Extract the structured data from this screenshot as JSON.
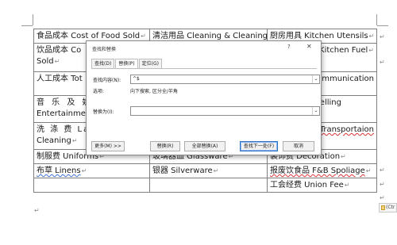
{
  "table": {
    "rows": [
      [
        "食品成本 Cost of Food Sold",
        "清洁用品 Cleaning & Cleaning",
        "厨房用具 Kitchen Utensils"
      ],
      [
        "饮品成本 Cost of Beverage Sold",
        "",
        "厨房燃料 Kitchen Fuel"
      ],
      [
        "人工成本 Total Labor Cost",
        "",
        "通讯费 Communication"
      ],
      [
        "音乐及娱乐 Music & Entertainment",
        "",
        "差旅费 Travelling"
      ],
      [
        "洗涤费 Laundry & Dry Cleaning",
        "",
        "交通费 Transportaion"
      ],
      [
        "制服费 Uniforms",
        "玻璃器皿 Glassware",
        "装饰费 Decoration"
      ],
      [
        "布草 Linens",
        "银器 Silverware",
        "报废饮食品 F&B Spoliage"
      ],
      [
        "",
        "",
        "工会经费 Union Fee"
      ]
    ],
    "visible_fragments": {
      "r1c0_line1": "饮品成本 Co",
      "r1c0_line2": "Sold",
      "r1c2": "Kitchen Fuel",
      "r2c0": "人工成本 Tot",
      "r2c2": "ommunication",
      "r3c0_line1": "音 乐 及 娱",
      "r3c0_line2": "Entertainmen",
      "r3c2": "费",
      "r3c2b": "Travelling",
      "r4c0_line1": "洗 涤 费  La",
      "r4c0_line2": "Cleaning",
      "r4c2": "Transportaion"
    }
  },
  "paste_options": {
    "label": "(Ctr"
  },
  "dialog": {
    "title": "查找和替换",
    "help": "?",
    "close": "✕",
    "tabs": [
      {
        "label": "查找(D)",
        "active": false
      },
      {
        "label": "替换(P)",
        "active": true
      },
      {
        "label": "定位(G)",
        "active": false
      }
    ],
    "find_label": "查找内容(N):",
    "find_value": "^$",
    "options_label": "选项:",
    "options_value": "向下搜索, 区分全/半角",
    "replace_label": "替换为(I):",
    "replace_value": "",
    "buttons": {
      "more": "更多(M) >>",
      "replace": "替换(R)",
      "replace_all": "全部替换(A)",
      "find_next": "查找下一处(F)",
      "cancel": "取消"
    }
  },
  "colors": {
    "spell_underline": "#d33",
    "grammar_underline": "#3a6fd8",
    "default_button_border": "#2b73c9"
  }
}
